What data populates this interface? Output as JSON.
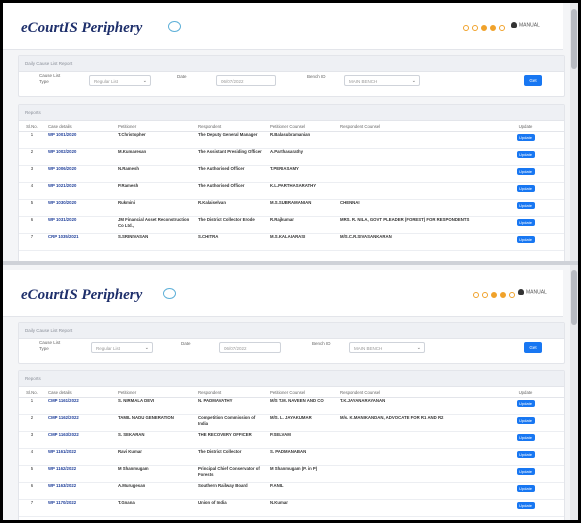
{
  "app": {
    "title": "eCourtIS Periphery",
    "user": "MANUAL"
  },
  "filter": {
    "heading": "Daily Cause List Report",
    "cause_list_type_label": "Cause List Type",
    "cause_list_type_value": "Regular List",
    "date_label": "Date",
    "date_value": "06/07/2022",
    "bench_label": "Bench ID",
    "bench_value": "MAIN BENCH",
    "get_label": "Get"
  },
  "reports": {
    "heading": "Reports",
    "columns": [
      "Sl.No.",
      "Case details",
      "Petitioner",
      "Respondent",
      "Petitioner Counsel",
      "Respondent Counsel",
      "Update"
    ],
    "update_label": "Update"
  },
  "panel1_rows": [
    {
      "no": "1",
      "case": "WP 1001/2020",
      "pet": "T.Christopher",
      "res": "The Deputy General Manager",
      "pc": "R.Balasubramanian",
      "rc": ""
    },
    {
      "no": "2",
      "case": "WP 1002/2020",
      "pet": "M.Kumaresan",
      "res": "The Assistant Presiding Officer",
      "pc": "A.Parthasarathy",
      "rc": ""
    },
    {
      "no": "3",
      "case": "WP 1006/2020",
      "pet": "N.Ramesh",
      "res": "The Authorised Officer",
      "pc": "T.PERIASAMY",
      "rc": ""
    },
    {
      "no": "4",
      "case": "WP 1021/2020",
      "pet": "P.Ramesh",
      "res": "The Authorised Officer",
      "pc": "K.L.PARTHASARATHY",
      "rc": ""
    },
    {
      "no": "5",
      "case": "WP 1030/2020",
      "pet": "Rukmini",
      "res": "R.Kalaiselvan",
      "pc": "M.S.SUBRAMANIAN",
      "rc": "CHENNAI"
    },
    {
      "no": "6",
      "case": "WP 1031/2020",
      "pet": "JM Financial Asset Reconstruction Co Ltd.,",
      "res": "The District Collector Erode",
      "pc": "R.Rajkumar",
      "rc": "MRS. R. NILA, GOVT PLEADER (FOREST) FOR RESPONDENTS"
    },
    {
      "no": "7",
      "case": "CRP 1035/2021",
      "pet": "S.SRINIVASAN",
      "res": "S.CHITRA",
      "pc": "M.S.KALAIARASI",
      "rc": "M/S.C.R.SIVASANKARAN"
    }
  ],
  "panel2_rows": [
    {
      "no": "1",
      "case": "CMP 1161/2022",
      "pet": "S. NIRMALA DEVI",
      "res": "N. PADMAVATHY",
      "pc": "M/S T.M. NAVEEN AND CO",
      "rc": "T.K.JAYANARAYANAN"
    },
    {
      "no": "2",
      "case": "CMP 1162/2022",
      "pet": "TAMIL NADU GENERATION",
      "res": "Competition Commission of India",
      "pc": "M/S. L. JAYAKUMAR",
      "rc": "M/s. K.MANIKANDAN, ADVOCATE FOR R1 AND R2"
    },
    {
      "no": "3",
      "case": "CMP 1163/2022",
      "pet": "S. SEKARAN",
      "res": "THE RECOVERY OFFICER",
      "pc": "P.SELVAM",
      "rc": ""
    },
    {
      "no": "4",
      "case": "WP 1161/2022",
      "pet": "Ravi Kumar",
      "res": "The District Collector",
      "pc": "S. PADMANABAN",
      "rc": ""
    },
    {
      "no": "5",
      "case": "WP 1162/2022",
      "pet": "M Shanmugam",
      "res": "Principal Chief Conservator of Forests",
      "pc": "M Shanmugam (P. in P)",
      "rc": ""
    },
    {
      "no": "6",
      "case": "WP 1163/2022",
      "pet": "A.Murugesan",
      "res": "Southern Railway Board",
      "pc": "P.ANIL",
      "rc": ""
    },
    {
      "no": "7",
      "case": "WP 1170/2022",
      "pet": "T.Gnana",
      "res": "Union of India",
      "pc": "N.Kumar",
      "rc": ""
    }
  ]
}
